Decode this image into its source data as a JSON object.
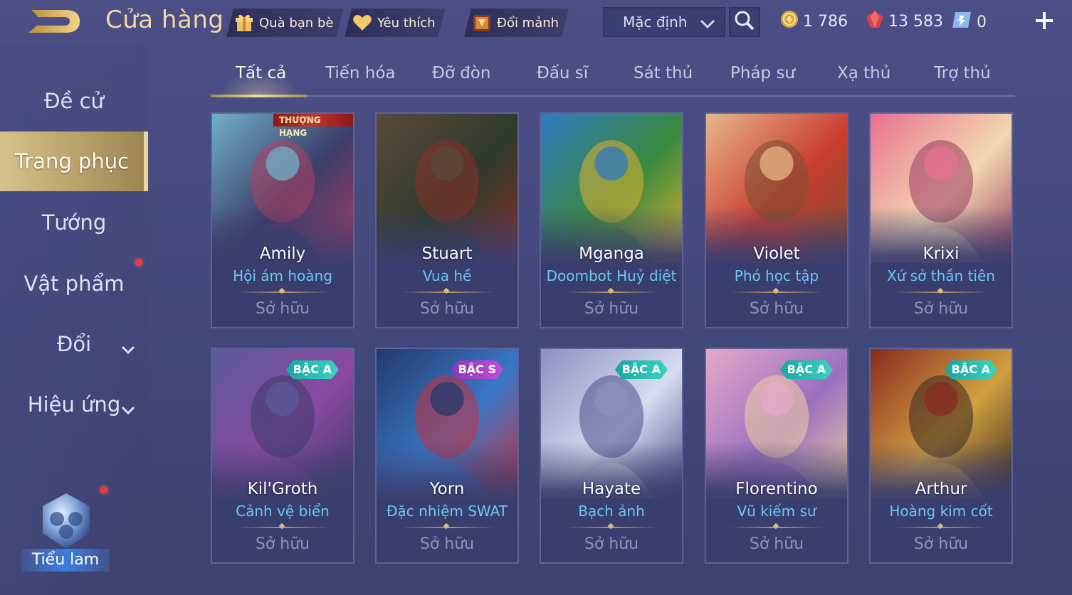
{
  "header": {
    "title": "Cửa hàng",
    "pills": [
      {
        "label": "Quà bạn bè",
        "icon": "gift-icon"
      },
      {
        "label": "Yêu thích",
        "icon": "heart-icon"
      },
      {
        "label": "Đổi mảnh",
        "icon": "shard-chest-icon"
      }
    ],
    "sort_value": "Mặc định",
    "currencies": [
      {
        "value": "1 786",
        "icon": "gold-coin-icon"
      },
      {
        "value": "13 583",
        "icon": "red-gem-icon"
      },
      {
        "value": "0",
        "icon": "voucher-icon"
      }
    ]
  },
  "sidebar": {
    "items": [
      {
        "label": "Đề cử"
      },
      {
        "label": "Trang phục"
      },
      {
        "label": "Tướng"
      },
      {
        "label": "Vật phẩm"
      },
      {
        "label": "Đổi"
      },
      {
        "label": "Hiệu ứng"
      }
    ],
    "avatar_label": "Tiểu lam"
  },
  "tabs": [
    "Tất cả",
    "Tiến hóa",
    "Đỡ đòn",
    "Đấu sĩ",
    "Sát thủ",
    "Pháp sư",
    "Xạ thủ",
    "Trợ thủ"
  ],
  "cards": [
    {
      "hero": "Amily",
      "skin": "Hội ám hoàng",
      "status": "Sở hữu",
      "tag": "THƯỢNG HẠNG",
      "colors": [
        "#6fb0c8",
        "#3c3d6a",
        "#b04060"
      ]
    },
    {
      "hero": "Stuart",
      "skin": "Vua hề",
      "status": "Sở hữu",
      "tag": "",
      "colors": [
        "#5b4a3c",
        "#2e3a2a",
        "#8b2f2a"
      ]
    },
    {
      "hero": "Mganga",
      "skin": "Doombot Huỷ diệt",
      "status": "Sở hữu",
      "tag": "",
      "colors": [
        "#2f7ac0",
        "#3a8a3e",
        "#e0b030"
      ]
    },
    {
      "hero": "Violet",
      "skin": "Phó học tập",
      "status": "Sở hữu",
      "tag": "",
      "colors": [
        "#e8b68a",
        "#c93c30",
        "#7a5030"
      ]
    },
    {
      "hero": "Krixi",
      "skin": "Xứ sở thần tiên",
      "status": "Sở hữu",
      "tag": "",
      "colors": [
        "#e87090",
        "#f2d8b0",
        "#9a3a60"
      ]
    },
    {
      "hero": "Kil'Groth",
      "skin": "Cảnh vệ biển",
      "status": "Sở hữu",
      "badge": "BẬC A",
      "colors": [
        "#5a5a9a",
        "#8a4aa0",
        "#3a3a6a"
      ]
    },
    {
      "hero": "Yorn",
      "skin": "Đặc nhiệm SWAT",
      "status": "Sở hữu",
      "badge": "BẬC S",
      "colors": [
        "#233a6a",
        "#3a78c8",
        "#c8303a"
      ]
    },
    {
      "hero": "Hayate",
      "skin": "Bạch ảnh",
      "status": "Sở hữu",
      "badge": "BẬC A",
      "colors": [
        "#8a90c0",
        "#d8dcef",
        "#4a4e88"
      ]
    },
    {
      "hero": "Florentino",
      "skin": "Vũ kiếm sư",
      "status": "Sở hữu",
      "badge": "BẬC A",
      "colors": [
        "#e6a8c8",
        "#9a70c0",
        "#f0d0a0"
      ]
    },
    {
      "hero": "Arthur",
      "skin": "Hoàng kim cốt",
      "status": "Sở hữu",
      "badge": "BẬC A",
      "colors": [
        "#8a2a20",
        "#d0a040",
        "#3a2a20"
      ]
    }
  ]
}
